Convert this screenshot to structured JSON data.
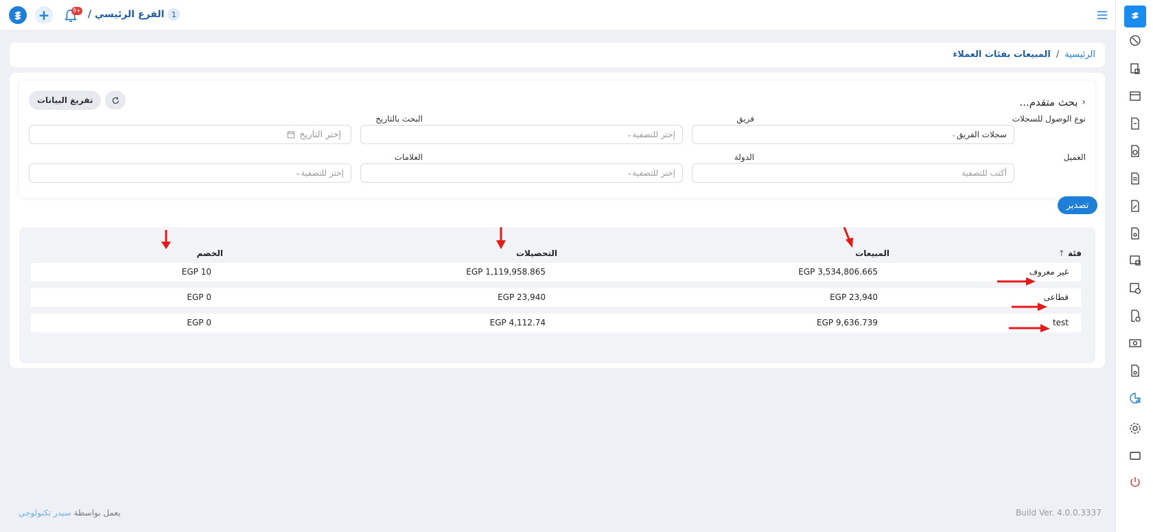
{
  "header": {
    "branch_label": "الفرع الرئيسي /",
    "branch_count": "1",
    "notification_count": "9+"
  },
  "breadcrumb": {
    "home": "الرئيسية",
    "separator": "/",
    "current": "المبيعات بفئات العملاء"
  },
  "advanced_search": {
    "title": "بحث متقدم...",
    "clear_button": "تفريغ البيانات",
    "fields": {
      "access_type": {
        "label": "نوع الوصول للسجلات",
        "value": "سجلات الفريق"
      },
      "team": {
        "label": "فريق",
        "placeholder": "إختر للتصفية"
      },
      "date_search": {
        "label": "البحث بالتاريخ",
        "placeholder": "إختر التاريخ"
      },
      "customer": {
        "label": "العميل",
        "placeholder": "أكتب للتصفية"
      },
      "country": {
        "label": "الدولة",
        "placeholder": "إختر للتصفية"
      },
      "tags": {
        "label": "العلامات",
        "placeholder": "إختر للتصفية"
      }
    }
  },
  "export_button": "تصدير",
  "table": {
    "columns": {
      "category": "فئة",
      "sales": "المبيعات",
      "collections": "التحصيلات",
      "discount": "الخصم"
    },
    "rows": [
      {
        "category": "غير معروف",
        "sales": "EGP 3,534,806.665",
        "collections": "EGP 1,119,958.865",
        "discount": "EGP 10"
      },
      {
        "category": "قطاعى",
        "sales": "EGP 23,940",
        "collections": "EGP 23,940",
        "discount": "EGP 0"
      },
      {
        "category": "test",
        "sales": "EGP 9,636.739",
        "collections": "EGP 4,112.74",
        "discount": "EGP 0"
      }
    ]
  },
  "footer": {
    "powered_by": "يعمل بواسطة",
    "company": "سيدر تكنولوجي",
    "build": "Build Ver. 4.0.0.3337"
  },
  "colors": {
    "accent": "#1e7fd8",
    "annotation_arrow": "#e81818"
  }
}
